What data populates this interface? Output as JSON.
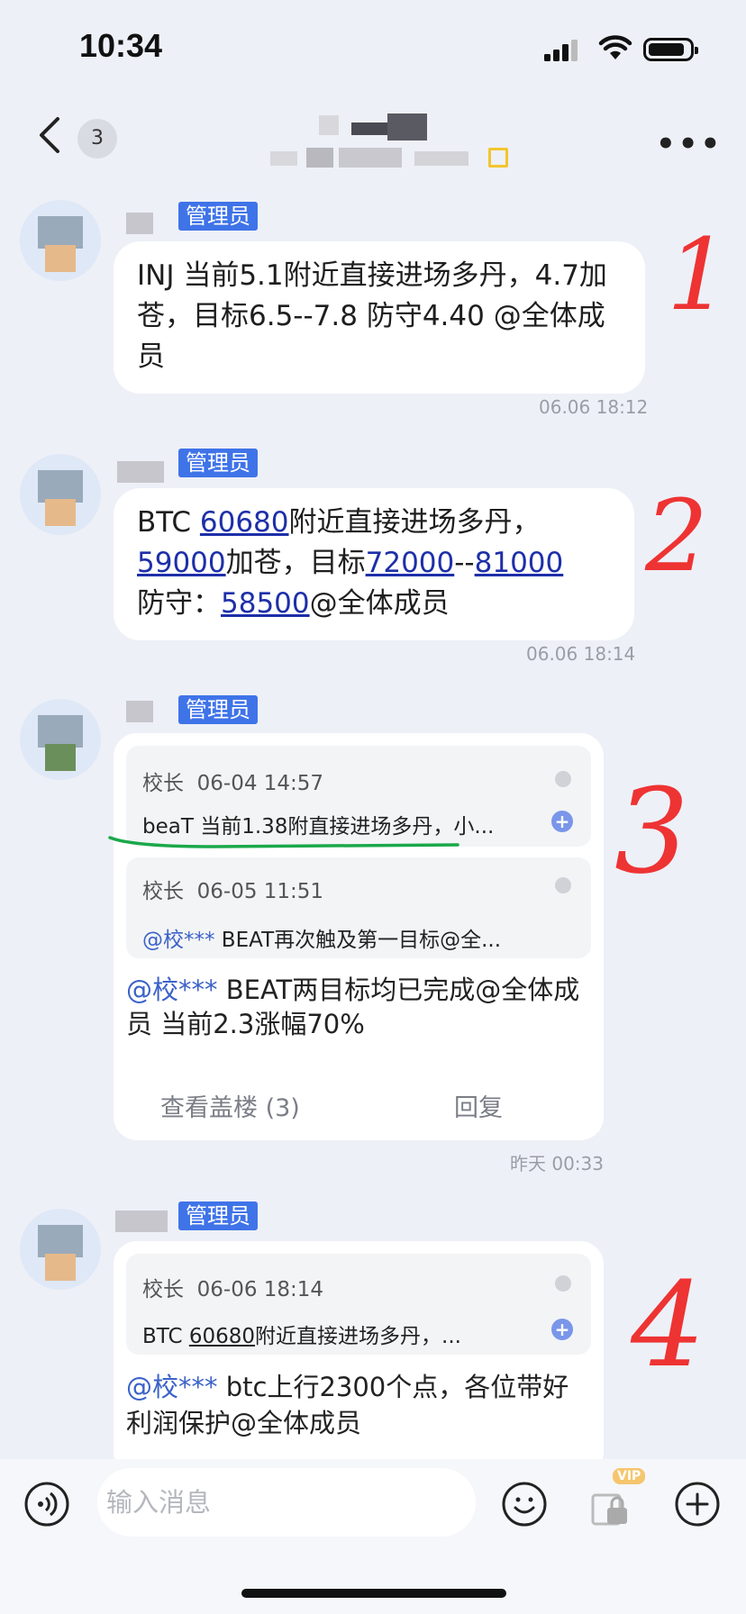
{
  "status": {
    "time": "10:34"
  },
  "nav": {
    "unread_count": "3"
  },
  "messages": [
    {
      "role": "管理员",
      "segments": [
        {
          "t": "INJ 当前5.1附近直接进场多丹，4.7加苍，目标6.5--7.8  防守4.40 @全体成员",
          "link": false
        }
      ],
      "timestamp": "06.06 18:12",
      "annotation": "1"
    },
    {
      "role": "管理员",
      "line1": [
        "BTC ",
        "60680",
        "附近直接进场多丹，"
      ],
      "line2": [
        "59000",
        "加苍，目标",
        "72000",
        "--",
        "81000"
      ],
      "line3": [
        "防守：",
        "58500",
        "@全体成员"
      ],
      "timestamp": "06.06 18:14",
      "annotation": "2"
    },
    {
      "role": "管理员",
      "quotes": [
        {
          "author": "校长",
          "time": "06-04 14:57",
          "text": "beaT 当前1.38附直接进场多丹，小..."
        },
        {
          "author": "校长",
          "time": "06-05 11:51",
          "mention": "@校***",
          "text": " BEAT再次触及第一目标@全..."
        }
      ],
      "mention": "@校***",
      "body_line1": " BEAT两目标均已完成@全体成",
      "body_line2": "员 当前2.3涨幅70%",
      "view_floor": "查看盖楼 (3)",
      "reply": "回复",
      "timestamp": "昨天 00:33",
      "annotation": "3"
    },
    {
      "role": "管理员",
      "quote": {
        "author": "校长",
        "time": "06-06 18:14",
        "pre": "BTC ",
        "link": "60680",
        "text": "附近直接进场多丹，..."
      },
      "mention": "@校***",
      "body_line1": " btc上行2300个点，各位带好",
      "body_line2": "利润保护@全体成员",
      "annotation": "4"
    }
  ],
  "composer": {
    "placeholder": "输入消息",
    "vip": "VIP"
  },
  "colors": {
    "admin_badge": "#3f73e8",
    "link": "#1d2fa8",
    "mention": "#3b62c9",
    "annotation": "#e33333",
    "underline": "#1aa84a"
  },
  "icons": [
    "back-icon",
    "more-icon",
    "voice-icon",
    "emoji-icon",
    "lock-icon",
    "plus-icon"
  ]
}
